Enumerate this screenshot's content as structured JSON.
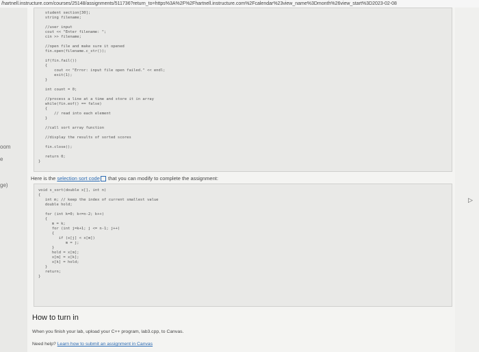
{
  "browser": {
    "url": "/hartnell.instructure.com/courses/25148/assignments/511736?return_to=https%3A%2F%2Fhartnell.instructure.com%2Fcalendar%23view_name%3Dmonth%26view_start%3D2023-02-08"
  },
  "nav_fragments": [
    "oom",
    "e",
    "ge)"
  ],
  "code_top": [
    "   student section[30];",
    "   string filename;",
    "",
    "   //user input",
    "   cout << \"Enter filename: \";",
    "   cin >> filename;",
    "",
    "   //open file and make sure it opened",
    "   fin.open(filename.c_str());",
    "",
    "   if(fin.fail())",
    "   {",
    "       cout << \"Error: input file open failed.\" << endl;",
    "       exit(1);",
    "   }",
    "",
    "   int count = 0;",
    "",
    "   //process a line at a time and store it in array",
    "   while(fin.eof() == false)",
    "   {",
    "       // read into each element",
    "   }",
    "",
    "   //call sort array function",
    "",
    "   //display the results of sorted scores",
    "",
    "   fin.close();",
    "",
    "   return 0;",
    "}"
  ],
  "lead_prefix": "Here is the ",
  "lead_link": "selection sort code",
  "lead_suffix": " that you can modify to complete the assignment:",
  "code_sort": [
    "void s_sort(double x[], int n)",
    "{",
    "   int m; // keep the index of current smallest value",
    "   double hold;",
    "",
    "   for (int k=0; k<=n-2; k++)",
    "   {",
    "      m = k;",
    "      for (int j=k+1; j <= n-1; j++)",
    "      {",
    "         if (x[j] < x[m])",
    "            m = j;",
    "      }",
    "      hold = x[m];",
    "      x[m] = x[k];",
    "      x[k] = hold;",
    "   }",
    "   return;",
    "}"
  ],
  "turn_in": {
    "title": "How to turn in",
    "instruction": "When you finish your lab, upload your C++ program, lab3.cpp, to Canvas.",
    "help_prefix": "Need help? ",
    "help_link": "Learn how to submit an assignment in Canvas"
  }
}
